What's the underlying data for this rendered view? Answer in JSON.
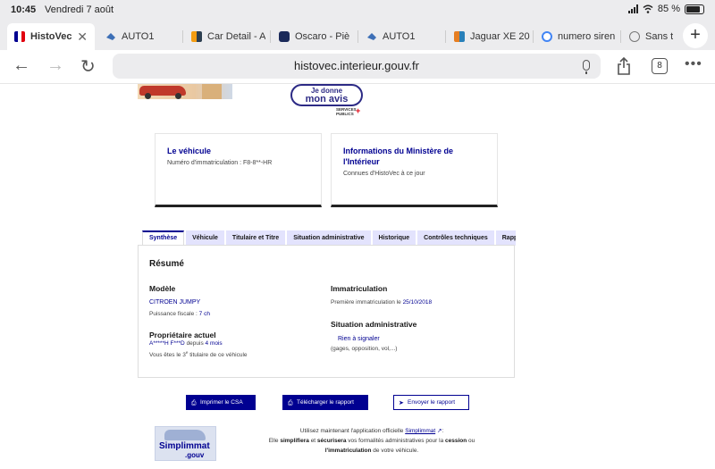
{
  "status_bar": {
    "time": "10:45",
    "date": "Vendredi 7 août",
    "battery_text": "85 %",
    "battery_level": 0.85
  },
  "tabs": [
    {
      "label": "HistoVec",
      "icon": "french-flag-icon",
      "active": true
    },
    {
      "label": "AUTO1",
      "icon": "auto1-icon"
    },
    {
      "label": "Car Detail - A",
      "icon": "car-detail-icon"
    },
    {
      "label": "Oscaro - Piè",
      "icon": "oscaro-icon"
    },
    {
      "label": "AUTO1",
      "icon": "auto1-icon"
    },
    {
      "label": "Jaguar XE 20",
      "icon": "jaguar-icon"
    },
    {
      "label": "numero siren",
      "icon": "google-icon"
    },
    {
      "label": "Sans t",
      "icon": "globe-icon"
    }
  ],
  "toolbar": {
    "url": "histovec.interieur.gouv.fr",
    "tab_count": "8"
  },
  "donne_avis": {
    "line1": "Je donne",
    "line2": "mon avis",
    "services_line1": "SERVICES",
    "services_line2": "PUBLICS"
  },
  "card_vehicle": {
    "title": "Le véhicule",
    "text": "Numéro d'immatriculation : F8-8**-HR"
  },
  "card_ministry": {
    "title": "Informations du Ministère de l'Intérieur",
    "text": "Connues d'HistoVec à ce jour"
  },
  "page_tabs": [
    "Synthèse",
    "Véhicule",
    "Titulaire et Titre",
    "Situation administrative",
    "Historique",
    "Contrôles techniques",
    "Rapport"
  ],
  "summary": {
    "title": "Résumé",
    "model_label": "Modèle",
    "model_value": "CITROEN JUMPY",
    "fiscal_label": "Puissance fiscale :",
    "fiscal_value": "7 ch",
    "owner_label": "Propriétaire actuel",
    "owner_name": "A*****H F***D",
    "owner_since_label": "depuis",
    "owner_since_value": "4 mois",
    "holder_prefix": "Vous êtes le",
    "holder_number": "3",
    "holder_sup": "e",
    "holder_suffix": "titulaire de ce véhicule",
    "registration_label": "Immatriculation",
    "first_registration_label": "Première immatriculation le",
    "first_registration_value": "25/10/2018",
    "admin_label": "Situation administrative",
    "admin_value": "Rien à signaler",
    "admin_note": "(gages, opposition, vol,...)"
  },
  "actions": {
    "print": "Imprimer le CSA",
    "download": "Télécharger le rapport",
    "send": "Envoyer le rapport"
  },
  "simplimmat": {
    "logo_name": "Simplimmat",
    "logo_domain": ".gouv",
    "line1_prefix": "Utilisez maintenant l'application officielle",
    "line1_link": "Simplimmat",
    "line1_suffix": ":",
    "line2_a": "Elle",
    "line2_b": "simplifiera",
    "line2_c": "et",
    "line2_d": "sécurisera",
    "line2_e": "vos formalités administratives pour la",
    "line2_f": "cession",
    "line2_g": "ou",
    "line3_a": "l'immatriculation",
    "line3_b": "de votre véhicule."
  },
  "colors": {
    "accent": "#000091",
    "tab_bg": "#e3e3fd",
    "flag_red": "#e1000f"
  }
}
